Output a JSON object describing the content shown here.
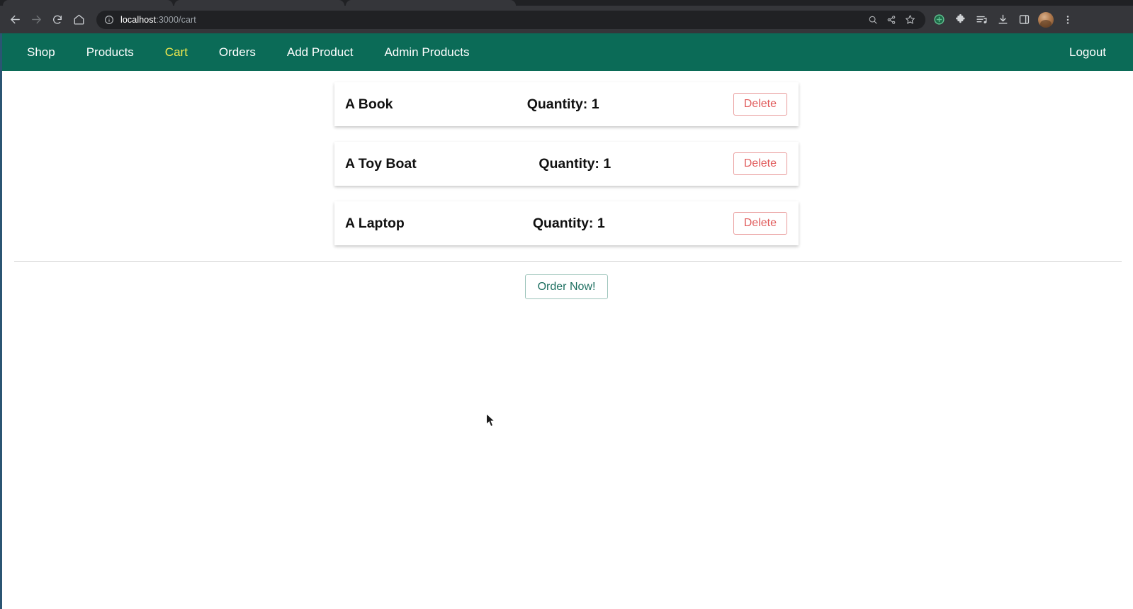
{
  "browser": {
    "back_icon": "back-arrow-icon",
    "forward_icon": "forward-arrow-icon",
    "reload_icon": "reload-icon",
    "home_icon": "home-icon",
    "site_info_icon": "info-circle-icon",
    "url_host": "localhost",
    "url_path": ":3000/cart",
    "url_full": "localhost:3000/cart",
    "omnibox_icons": [
      "zoom-icon",
      "share-icon",
      "bookmark-star-icon"
    ],
    "toolbar_icons": [
      "add-circle-icon",
      "extensions-puzzle-icon",
      "reading-list-icon",
      "downloads-icon",
      "side-panel-icon"
    ],
    "avatar": "profile-avatar",
    "menu_icon": "three-dot-menu-icon",
    "chrome_bg": "#35363a",
    "omnibox_bg": "#202124"
  },
  "nav": {
    "brand_color": "#0b6b57",
    "active_color": "#f2e94e",
    "links": [
      {
        "label": "Shop",
        "active": false
      },
      {
        "label": "Products",
        "active": false
      },
      {
        "label": "Cart",
        "active": true
      },
      {
        "label": "Orders",
        "active": false
      },
      {
        "label": "Add Product",
        "active": false
      },
      {
        "label": "Admin Products",
        "active": false
      }
    ],
    "logout_label": "Logout"
  },
  "cart": {
    "delete_label": "Delete",
    "delete_color": "#e05b5b",
    "items": [
      {
        "title": "A Book",
        "quantity_label": "Quantity: 1",
        "quantity": 1
      },
      {
        "title": "A Toy Boat",
        "quantity_label": "Quantity: 1",
        "quantity": 1
      },
      {
        "title": "A Laptop",
        "quantity_label": "Quantity: 1",
        "quantity": 1
      }
    ],
    "order_button_label": "Order Now!",
    "order_button_color": "#1d6f60"
  }
}
